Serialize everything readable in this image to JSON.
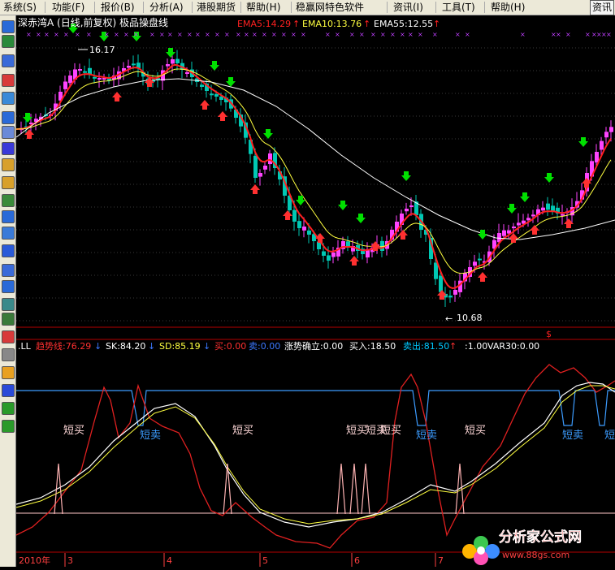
{
  "menu": {
    "items": [
      "系统(S)",
      "功能(F)",
      "报价(B)",
      "分析(A)",
      "港股期货",
      "帮助(H)",
      "稳赢网特色软件",
      "资讯(I)",
      "工具(T)",
      "帮助(H)"
    ],
    "news_button": "资讯"
  },
  "toolbar": {
    "icons": [
      "grid-icon",
      "chart-icon",
      "list-icon",
      "line-chart-icon",
      "candle-icon",
      "report-icon",
      "table-icon",
      "f10-icon",
      "funds-icon",
      "alert-icon",
      "users-icon",
      "formula-icon",
      "search-icon",
      "etf-icon",
      "wave-icon",
      "rsi-icon",
      "stats-icon",
      "swap-icon",
      "dollar-icon",
      "wrench-icon",
      "pencil-icon",
      "move-icon",
      "up-arrow-icon",
      "down-arrow-icon"
    ]
  },
  "main_chart": {
    "title": "深赤湾A (日线,前复权) 极品操盘线",
    "ema5": "EMA5:14.29",
    "ema10": "EMA10:13.76",
    "ema55": "EMA55:12.55",
    "high_label": "16.17",
    "low_label": "10.68",
    "colors": {
      "up": "#ff44ff",
      "down": "#00c8b4",
      "ema5": "#ff2020",
      "ema10": "#ffff40",
      "ema55": "#ffffff",
      "buy_arrow": "#ff3030",
      "sell_arrow": "#00e000"
    }
  },
  "indicator": {
    "name": ".LL",
    "trend": "趋势线:76.29",
    "sk": "SK:84.20",
    "sd": "SD:85.19",
    "buy": "买:0.00",
    "sell": "卖:0.00",
    "trend_confirm": "涨势确立:0.00",
    "buy_in": "买入:18.50",
    "sell_out": "卖出:81.50",
    "ratio": ":1.00",
    "var30": "VAR30:0.00",
    "short_buy": "短买",
    "short_sell": "短卖",
    "dollar": "$"
  },
  "time_axis": {
    "labels": [
      "2010年",
      "3",
      "4",
      "5",
      "6",
      "7"
    ]
  },
  "watermark": {
    "brand": "分析家公式网",
    "url": "www.88gs.com"
  }
}
